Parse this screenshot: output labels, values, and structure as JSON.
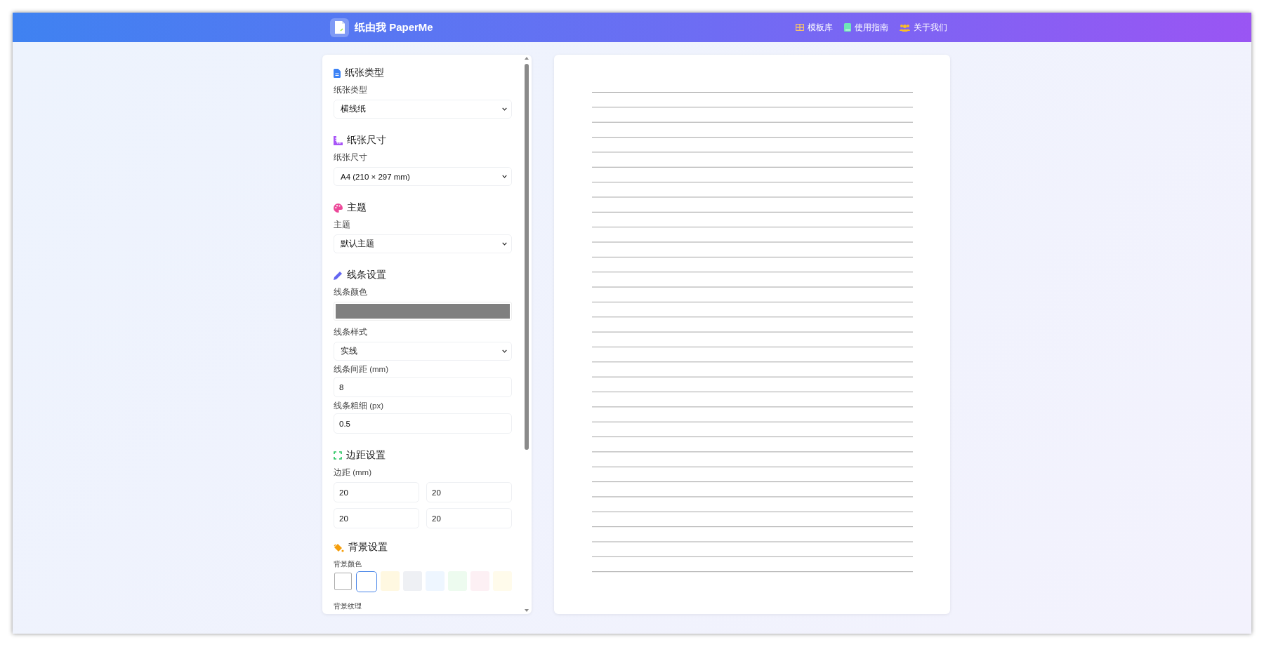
{
  "header": {
    "logo_text": "纸由我 PaperMe",
    "nav": [
      {
        "label": "模板库"
      },
      {
        "label": "使用指南"
      },
      {
        "label": "关于我们"
      }
    ]
  },
  "settings": {
    "sections": [
      {
        "title": "纸张类型",
        "fields": [
          {
            "kind": "select",
            "label": "纸张类型",
            "value": "横线纸"
          }
        ]
      },
      {
        "title": "纸张尺寸",
        "fields": [
          {
            "kind": "select",
            "label": "纸张尺寸",
            "value": "A4 (210 × 297 mm)"
          }
        ]
      },
      {
        "title": "主题",
        "fields": [
          {
            "kind": "select",
            "label": "主题",
            "value": "默认主题"
          }
        ]
      },
      {
        "title": "线条设置",
        "fields": [
          {
            "kind": "color",
            "label": "线条颜色",
            "color": "#808080"
          },
          {
            "kind": "select",
            "label": "线条样式",
            "value": "实线"
          },
          {
            "kind": "input",
            "label": "线条间距 (mm)",
            "value": "8"
          },
          {
            "kind": "input",
            "label": "线条粗细 (px)",
            "value": "0.5"
          }
        ]
      },
      {
        "title": "边距设置",
        "fields": [
          {
            "kind": "grid",
            "label": "边距 (mm)",
            "values": [
              "20",
              "20",
              "20",
              "20"
            ]
          }
        ]
      },
      {
        "title": "背景设置",
        "fields": [
          {
            "kind": "swatches",
            "label": "背景颜色",
            "swatches": [
              {
                "color": "#ffffff",
                "selected": false
              },
              {
                "color": "#ffffff",
                "selected": true
              },
              {
                "color": "#fff8e1",
                "selected": false
              },
              {
                "color": "#eef0f4",
                "selected": false
              },
              {
                "color": "#eef6ff",
                "selected": false
              },
              {
                "color": "#edfbef",
                "selected": false
              },
              {
                "color": "#fdf0f4",
                "selected": false
              },
              {
                "color": "#fffbeb",
                "selected": false
              }
            ]
          },
          {
            "kind": "heading_only",
            "label": "背景纹理"
          }
        ]
      }
    ]
  }
}
